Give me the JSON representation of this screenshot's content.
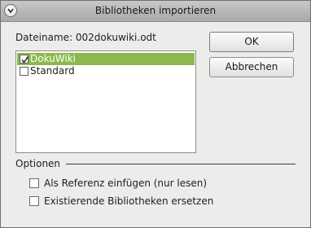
{
  "window": {
    "title": "Bibliotheken importieren"
  },
  "file": {
    "label": "Dateiname: 002dokuwiki.odt"
  },
  "libraries": [
    {
      "label": "DokuWiki",
      "checked": true,
      "selected": true
    },
    {
      "label": "Standard",
      "checked": false,
      "selected": false
    }
  ],
  "buttons": {
    "ok": "OK",
    "cancel": "Abbrechen"
  },
  "options": {
    "title": "Optionen",
    "reference": {
      "label": "Als Referenz einfügen (nur lesen)",
      "checked": false
    },
    "replace": {
      "label": "Existierende Bibliotheken ersetzen",
      "checked": false
    }
  },
  "colors": {
    "selection": "#8cb84e",
    "titlebar": "#b8b8b8"
  }
}
